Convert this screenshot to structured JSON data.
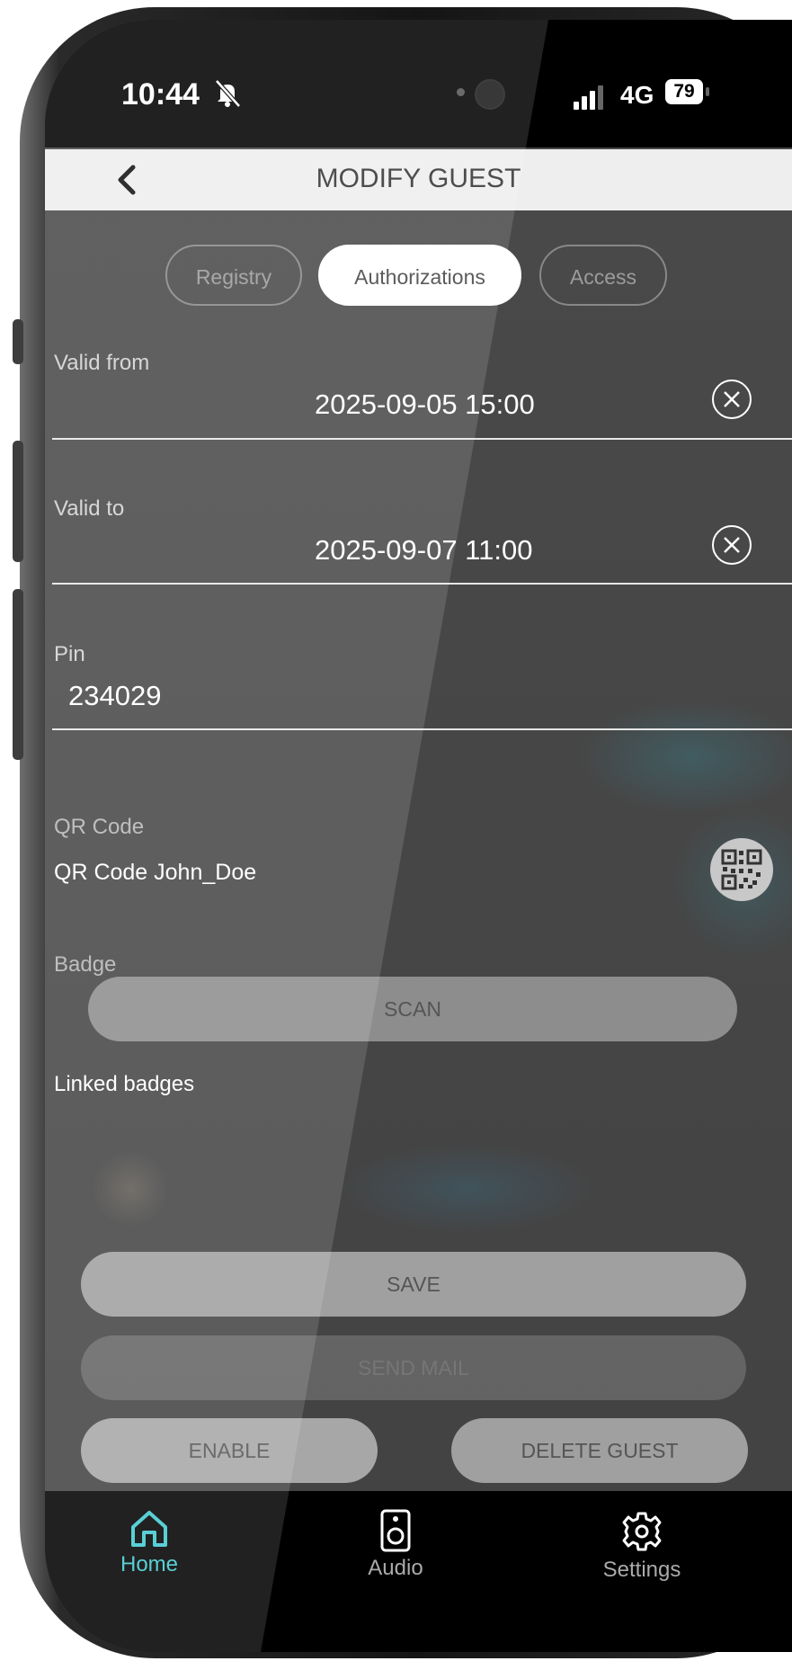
{
  "status_bar": {
    "time": "10:44",
    "network": "4G",
    "battery": "79"
  },
  "header": {
    "title": "MODIFY GUEST"
  },
  "tabs": [
    {
      "label": "Registry",
      "active": false
    },
    {
      "label": "Authorizations",
      "active": true
    },
    {
      "label": "Access",
      "active": false
    }
  ],
  "form": {
    "valid_from": {
      "label": "Valid from",
      "value": "2025-09-05 15:00"
    },
    "valid_to": {
      "label": "Valid to",
      "value": "2025-09-07 11:00"
    },
    "pin": {
      "label": "Pin",
      "value": "234029"
    },
    "qr_code": {
      "label": "QR Code",
      "value": "QR Code John_Doe"
    },
    "badge": {
      "label": "Badge",
      "scan_label": "SCAN"
    },
    "linked_badges": {
      "label": "Linked badges"
    }
  },
  "actions": {
    "save": "SAVE",
    "send_mail": "SEND MAIL",
    "enable": "ENABLE",
    "delete_guest": "DELETE GUEST"
  },
  "bottom_nav": [
    {
      "label": "Home",
      "icon": "home-icon",
      "active": true
    },
    {
      "label": "Audio",
      "icon": "speaker-icon",
      "active": false
    },
    {
      "label": "Settings",
      "icon": "gear-icon",
      "active": false
    }
  ],
  "colors": {
    "accent": "#40c8cf",
    "header_bg": "#eeeeee",
    "screen_bg": "#4a4a4a"
  }
}
